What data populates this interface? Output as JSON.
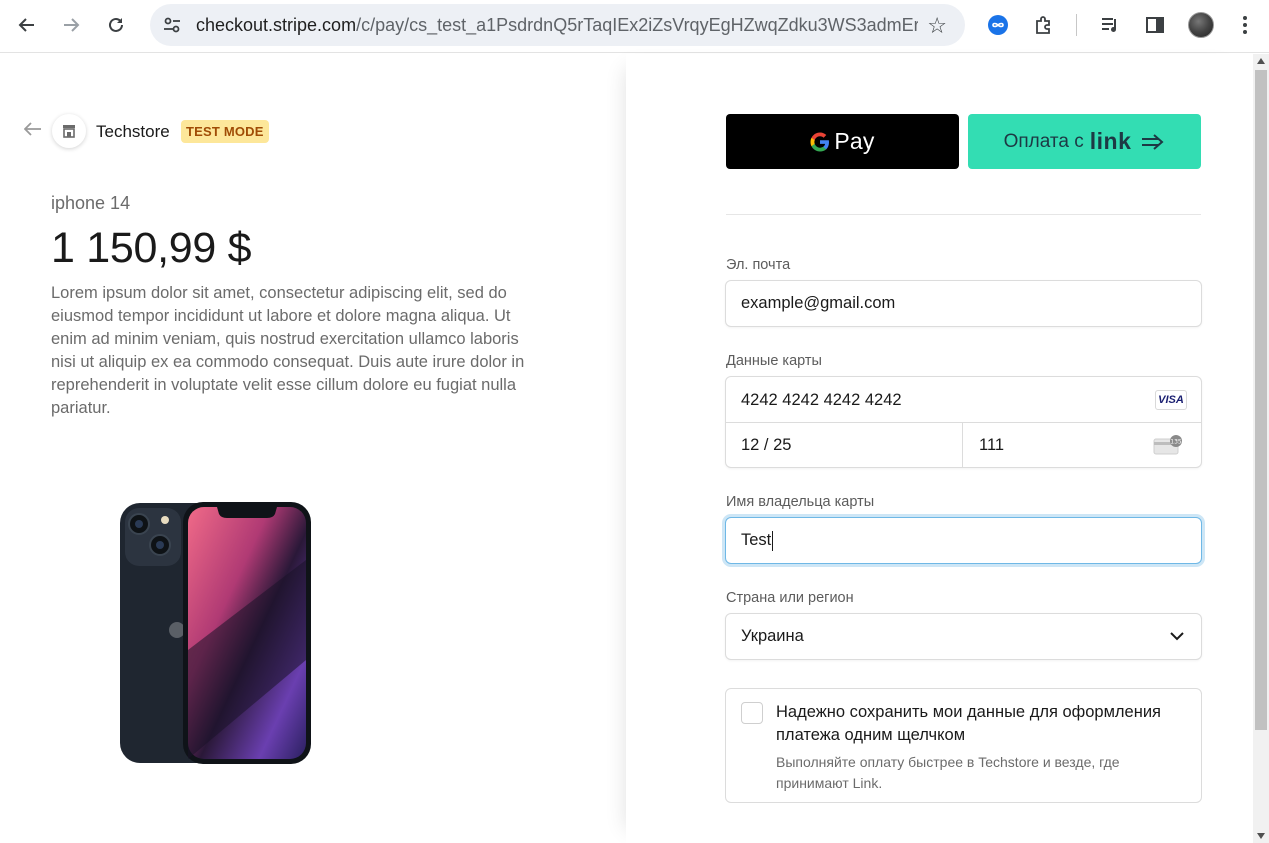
{
  "browser": {
    "url_host": "checkout.stripe.com",
    "url_path": "/c/pay/cs_test_a1PsdrdnQ5rTaqIEx2iZsVrqyEgHZwqZdku3WS3admErBA..."
  },
  "merchant": {
    "name": "Techstore",
    "badge": "TEST MODE"
  },
  "product": {
    "name": "iphone 14",
    "price": "1 150,99 $",
    "description": "Lorem ipsum dolor sit amet, consectetur adipiscing elit, sed do eiusmod tempor incididunt ut labore et dolore magna aliqua. Ut enim ad minim veniam, quis nostrud exercitation ullamco laboris nisi ut aliquip ex ea commodo consequat. Duis aute irure dolor in reprehenderit in voluptate velit esse cillum dolore eu fugiat nulla pariatur."
  },
  "express": {
    "gpay_label": "Pay",
    "link_prefix": "Оплата с",
    "link_word": "link"
  },
  "form": {
    "email_label": "Эл. почта",
    "email_value": "example@gmail.com",
    "card_label": "Данные карты",
    "card_number": "4242 4242 4242 4242",
    "card_brand": "VISA",
    "card_expiry": "12 / 25",
    "card_cvc": "111",
    "name_label": "Имя владельца карты",
    "name_value": "Test",
    "country_label": "Страна или регион",
    "country_value": "Украина"
  },
  "save_info": {
    "title": "Надежно сохранить мои данные для оформления платежа одним щелчком",
    "description": "Выполняйте оплату быстрее в Techstore и везде, где принимают Link.",
    "checked": false
  },
  "colors": {
    "link_button": "#33ddb3",
    "test_badge_bg": "#fde79a",
    "test_badge_text": "#a04c05",
    "focus_ring": "#6fb8e6"
  },
  "icons": [
    "back-icon",
    "forward-icon",
    "reload-icon",
    "site-info-icon",
    "bookmark-star-icon",
    "infinity-extension-icon",
    "puzzle-extensions-icon",
    "media-queue-icon",
    "side-panel-icon",
    "kebab-menu-icon",
    "store-icon",
    "google-g-icon",
    "link-arrow-icon",
    "visa-icon",
    "cvc-card-icon",
    "chevron-down-icon"
  ]
}
